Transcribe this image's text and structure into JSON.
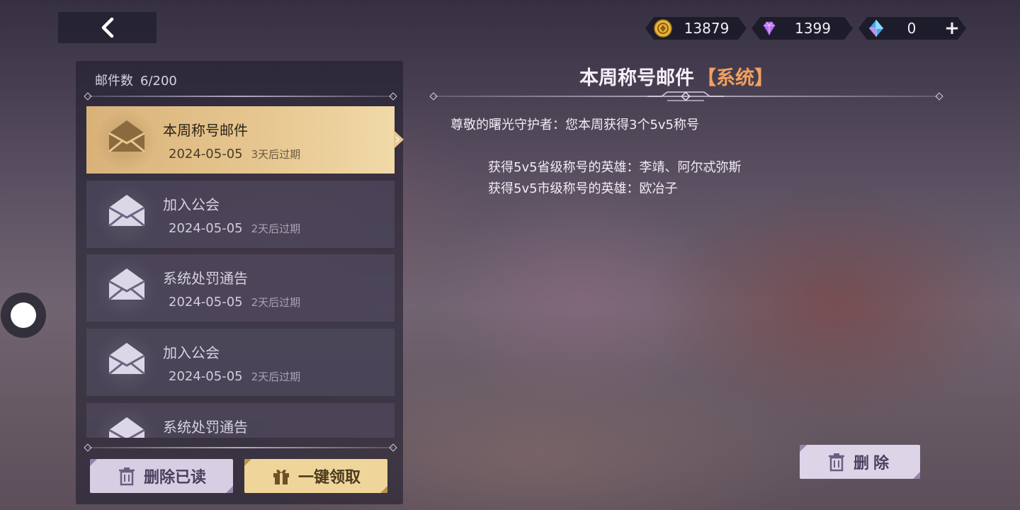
{
  "header": {
    "back_icon": "chevron-left-icon",
    "currencies": [
      {
        "icon": "gold-coin-icon",
        "value": "13879"
      },
      {
        "icon": "purple-diamond-icon",
        "value": "1399"
      },
      {
        "icon": "blue-crystal-icon",
        "value": "0",
        "action": "+"
      }
    ]
  },
  "mailbox": {
    "count_label": "邮件数",
    "count_value": "6/200",
    "items": [
      {
        "title": "本周称号邮件",
        "date": "2024-05-05",
        "expiry": "3天后过期",
        "selected": true
      },
      {
        "title": "加入公会",
        "date": "2024-05-05",
        "expiry": "2天后过期",
        "selected": false
      },
      {
        "title": "系统处罚通告",
        "date": "2024-05-05",
        "expiry": "2天后过期",
        "selected": false
      },
      {
        "title": "加入公会",
        "date": "2024-05-05",
        "expiry": "2天后过期",
        "selected": false
      },
      {
        "title": "系统处罚通告",
        "date": "",
        "expiry": "",
        "selected": false
      }
    ],
    "delete_read_label": "删除已读",
    "claim_all_label": "一键领取"
  },
  "detail": {
    "title": "本周称号邮件",
    "tag": "【系统】",
    "greeting": "尊敬的曙光守护者：您本周获得3个5v5称号",
    "lines": [
      "获得5v5省级称号的英雄：李靖、阿尔忒弥斯",
      "获得5v5市级称号的英雄：欧冶子"
    ],
    "delete_label": "删除"
  },
  "colors": {
    "selected_bg": "#e7c891",
    "tag_orange": "#f2a060",
    "claim_button": "#f0d59a",
    "delete_button": "#ddd4e8"
  }
}
